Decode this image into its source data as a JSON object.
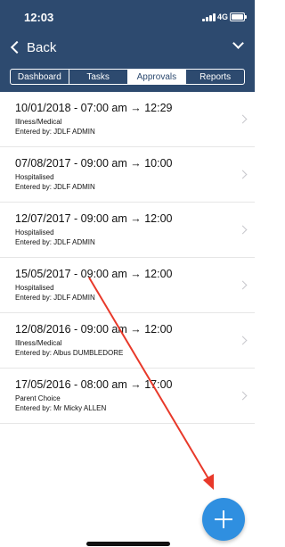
{
  "status_bar": {
    "time": "12:03",
    "network": "4G"
  },
  "nav": {
    "back_label": "Back"
  },
  "tabs": [
    {
      "label": "Dashboard",
      "active": false
    },
    {
      "label": "Tasks",
      "active": false
    },
    {
      "label": "Approvals",
      "active": true
    },
    {
      "label": "Reports",
      "active": false
    }
  ],
  "items": [
    {
      "title": "10/01/2018 - 07:00 am → 12:29",
      "type": "Illness/Medical",
      "entered": "Entered by: JDLF ADMIN"
    },
    {
      "title": "07/08/2017 - 09:00 am → 10:00",
      "type": "Hospitalised",
      "entered": "Entered by: JDLF ADMIN"
    },
    {
      "title": "12/07/2017 - 09:00 am → 12:00",
      "type": "Hospitalised",
      "entered": "Entered by: JDLF ADMIN"
    },
    {
      "title": "15/05/2017 - 09:00 am → 12:00",
      "type": "Hospitalised",
      "entered": "Entered by: JDLF ADMIN"
    },
    {
      "title": "12/08/2016 - 09:00 am → 12:00",
      "type": "Illness/Medical",
      "entered": "Entered by: Albus DUMBLEDORE"
    },
    {
      "title": "17/05/2016 - 08:00 am → 17:00",
      "type": "Parent Choice",
      "entered": "Entered by: Mr Micky ALLEN"
    }
  ],
  "colors": {
    "header": "#2d4a6f",
    "fab": "#2f8fe0",
    "annotation_arrow": "#e8392a"
  },
  "icons": {
    "back": "chevron-left-icon",
    "menu": "chevron-down-icon",
    "add": "plus-icon",
    "row": "chevron-right-icon"
  }
}
